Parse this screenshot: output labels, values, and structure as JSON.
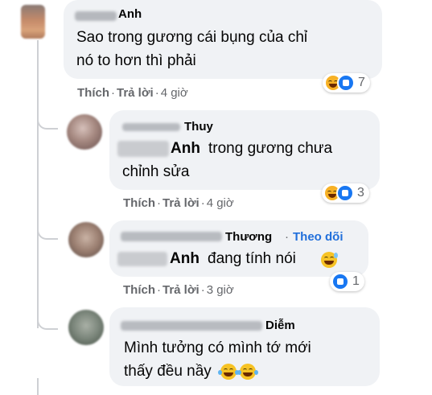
{
  "comments": [
    {
      "author": "Anh",
      "text_line1": "Sao trong gương cái bụng của chỉ",
      "text_line2": "nó to hơn thì phải",
      "like_label": "Thích",
      "reply_label": "Trả lời",
      "time": "4 giờ",
      "reaction_count": "7",
      "reactions": [
        "haha-icon",
        "like-icon"
      ]
    },
    {
      "author": "Thuy",
      "tag": "Anh",
      "text_line1": "trong gương chưa",
      "text_line2": "chỉnh sửa",
      "like_label": "Thích",
      "reply_label": "Trả lời",
      "time": "4 giờ",
      "reaction_count": "3",
      "reactions": [
        "haha-icon",
        "like-icon"
      ]
    },
    {
      "author": "Thương",
      "follow_label": "Theo dõi",
      "tag": "Anh",
      "text_line1": "đang tính nói",
      "trailing_emoji": "grinning-sweat-emoji",
      "like_label": "Thích",
      "reply_label": "Trả lời",
      "time": "3 giờ",
      "reaction_count": "1",
      "reactions": [
        "like-icon"
      ]
    },
    {
      "author": "Diễm",
      "text_line1": "Mình tưởng có mình tớ mới",
      "text_line2": "thấy đều nầy",
      "trailing_emoji": "tears-of-joy-emoji"
    }
  ],
  "colors": {
    "bubble_bg": "#f0f2f5",
    "link": "#216fdb",
    "meta_text": "#65676b",
    "like_blue": "#1877f2",
    "haha_yellow": "#f7b125"
  }
}
